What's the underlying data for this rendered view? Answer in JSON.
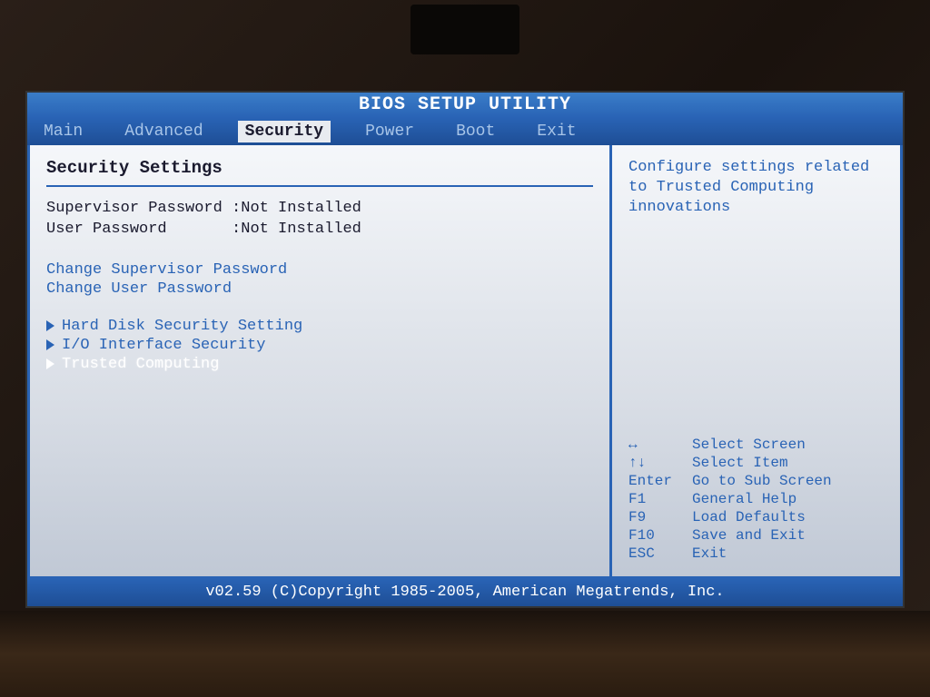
{
  "header": {
    "title": "BIOS SETUP UTILITY"
  },
  "tabs": {
    "items": [
      "Main",
      "Advanced",
      "Security",
      "Power",
      "Boot",
      "Exit"
    ],
    "active": "Security"
  },
  "main_panel": {
    "section_title": "Security Settings",
    "status": {
      "supervisor_label": "Supervisor Password :",
      "supervisor_value": "Not Installed",
      "user_label": "User Password       :",
      "user_value": "Not Installed"
    },
    "actions": {
      "change_supervisor": "Change Supervisor Password",
      "change_user": "Change User Password"
    },
    "submenus": {
      "hard_disk": "Hard Disk Security Setting",
      "io_interface": "I/O Interface Security",
      "trusted_computing": "Trusted Computing"
    }
  },
  "help_panel": {
    "description": "Configure settings related to Trusted Computing innovations",
    "keys": {
      "lr": {
        "key": "↔",
        "desc": "Select Screen"
      },
      "ud": {
        "key": "↑↓",
        "desc": "Select Item"
      },
      "enter": {
        "key": "Enter",
        "desc": "Go to Sub Screen"
      },
      "f1": {
        "key": "F1",
        "desc": "General Help"
      },
      "f9": {
        "key": "F9",
        "desc": "Load Defaults"
      },
      "f10": {
        "key": "F10",
        "desc": "Save and Exit"
      },
      "esc": {
        "key": "ESC",
        "desc": "Exit"
      }
    }
  },
  "footer": {
    "text": "v02.59 (C)Copyright 1985-2005, American Megatrends, Inc."
  }
}
